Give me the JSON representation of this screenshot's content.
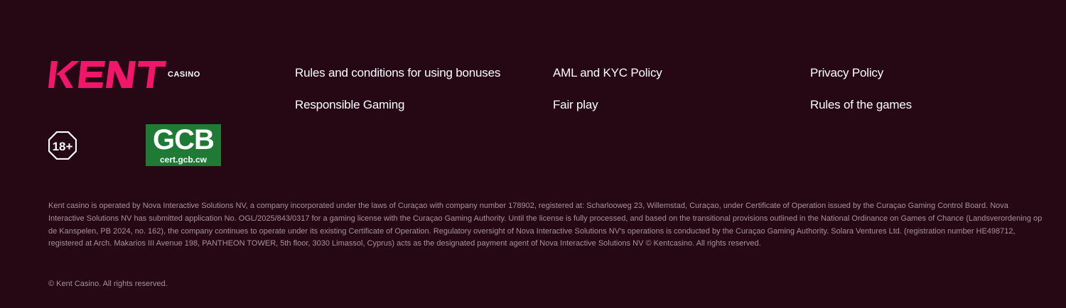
{
  "brand": {
    "name": "KENT",
    "sub": "CASINO",
    "accent": "#f0166a",
    "background": "#260814"
  },
  "nav": {
    "links": [
      {
        "label": "Rules and conditions for using bonuses"
      },
      {
        "label": "AML and KYC Policy"
      },
      {
        "label": "Privacy Policy"
      },
      {
        "label": "Responsible Gaming"
      },
      {
        "label": "Fair play"
      },
      {
        "label": "Rules of the games"
      }
    ]
  },
  "badges": {
    "age": "18+",
    "gcb_title": "GCB",
    "gcb_url": "cert.gcb.cw",
    "gcb_color": "#1e7a34"
  },
  "legal": {
    "text": "Kent casino is operated by Nova Interactive Solutions NV, a company incorporated under the laws of Curaçao with company number 178902, registered at: Scharlooweg 23, Willemstad, Curaçao, under Certificate of Operation issued by the Curaçao Gaming Control Board. Nova Interactive Solutions NV has submitted application No. OGL/2025/843/0317 for a gaming license with the Curaçao Gaming Authority. Until the license is fully processed, and based on the transitional provisions outlined in the National Ordinance on Games of Chance (Landsverordening op de Kanspelen, PB 2024, no. 162), the company continues to operate under its existing Certificate of Operation. Regulatory oversight of Nova Interactive Solutions NV's operations is conducted by the Curaçao Gaming Authority. Solara Ventures Ltd. (registration number HE498712, registered at Arch. Makarios III Avenue 198, PANTHEON TOWER, 5th floor, 3030 Limassol, Cyprus) acts as the designated payment agent of Nova Interactive Solutions NV © Kentcasino. All rights reserved.",
    "copyright": "© Kent Casino. All rights reserved."
  }
}
